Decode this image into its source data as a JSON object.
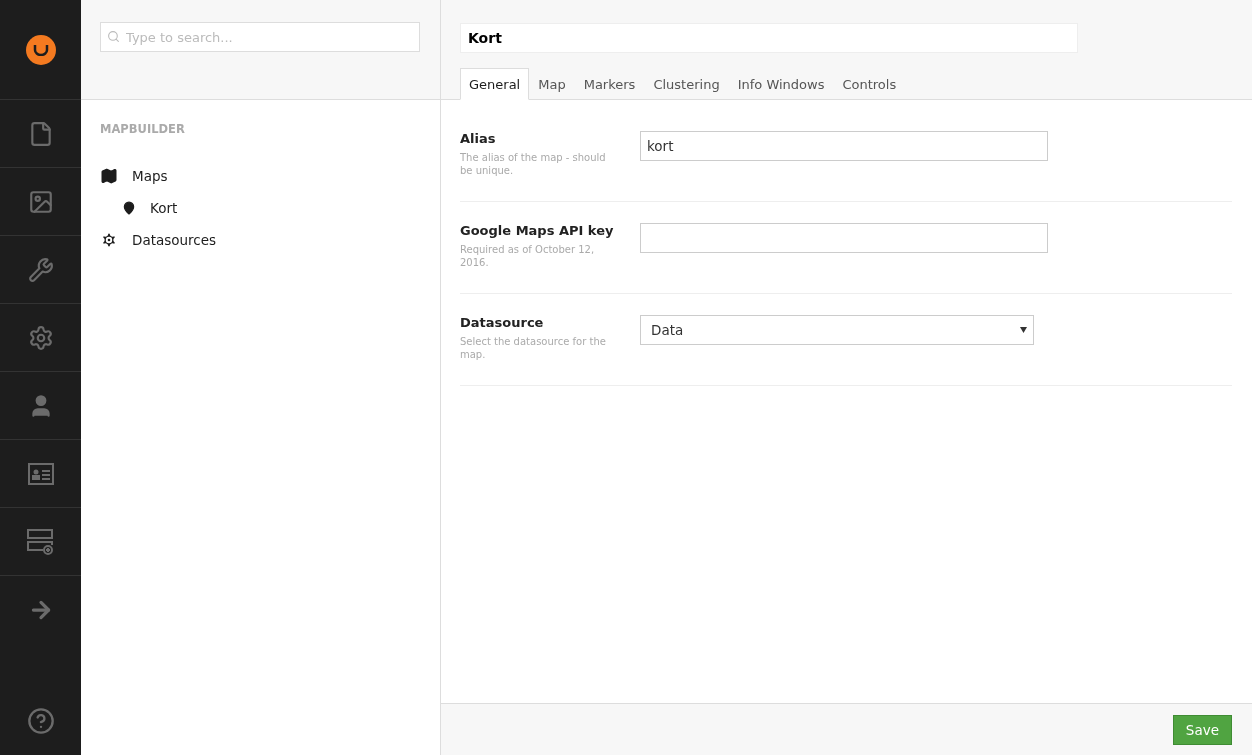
{
  "tree_panel": {
    "search": {
      "placeholder": "Type to search..."
    },
    "section_title": "MAPBUILDER",
    "items": [
      {
        "label": "Maps",
        "children": [
          {
            "label": "Kort"
          }
        ]
      },
      {
        "label": "Datasources"
      }
    ]
  },
  "editor": {
    "name": "Kort",
    "tabs": [
      {
        "label": "General",
        "selected": true
      },
      {
        "label": "Map",
        "selected": false
      },
      {
        "label": "Markers",
        "selected": false
      },
      {
        "label": "Clustering",
        "selected": false
      },
      {
        "label": "Info Windows",
        "selected": false
      },
      {
        "label": "Controls",
        "selected": false
      }
    ],
    "fields": [
      {
        "kind": "text",
        "label": "Alias",
        "description": "The alias of the map - should be unique.",
        "value": "kort"
      },
      {
        "kind": "text",
        "label": "Google Maps API key",
        "description": "Required as of October 12, 2016."
      },
      {
        "kind": "select",
        "label": "Datasource",
        "description": "Select the datasource for the map.",
        "value": "Data"
      }
    ],
    "save_button": "Save"
  }
}
